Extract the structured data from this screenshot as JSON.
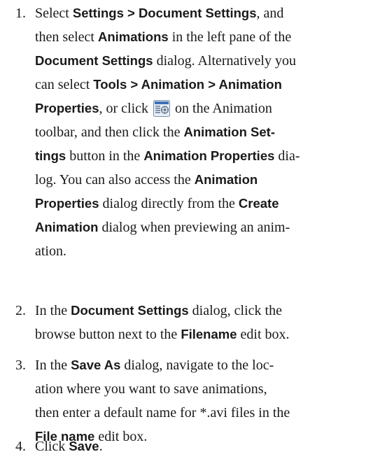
{
  "steps": [
    {
      "number": "1.",
      "lines": [
        [
          {
            "t": "Select "
          },
          {
            "b": "Settings > Document Settings"
          },
          {
            "t": ", and"
          }
        ],
        [
          {
            "t": "then select "
          },
          {
            "b": "Animations"
          },
          {
            "t": " in the left pane of the"
          }
        ],
        [
          {
            "b": "Document Settings"
          },
          {
            "t": " dialog. Alternatively you"
          }
        ],
        [
          {
            "t": "can select "
          },
          {
            "b": "Tools > Animation > Animation"
          }
        ],
        [
          {
            "b": "Properties"
          },
          {
            "t": ", or click "
          },
          {
            "icon": "animation-properties-icon"
          },
          {
            "t": " on the Animation"
          }
        ],
        [
          {
            "t": "toolbar, and then click the "
          },
          {
            "b": "Animation Set-"
          }
        ],
        [
          {
            "b": "tings"
          },
          {
            "t": " button in the "
          },
          {
            "b": "Animation Properties"
          },
          {
            "t": " dia-"
          }
        ],
        [
          {
            "t": "log. You can also access the "
          },
          {
            "b": "Animation"
          }
        ],
        [
          {
            "b": "Properties"
          },
          {
            "t": " dialog directly from the "
          },
          {
            "b": "Create"
          }
        ],
        [
          {
            "b": "Animation"
          },
          {
            "t": " dialog when previewing an anim-"
          }
        ],
        [
          {
            "t": "ation."
          }
        ]
      ]
    },
    {
      "number": "2.",
      "lines": [
        [
          {
            "t": "In the "
          },
          {
            "b": "Document Settings"
          },
          {
            "t": " dialog, click the"
          }
        ],
        [
          {
            "t": "browse button next to the "
          },
          {
            "b": "Filename"
          },
          {
            "t": " edit box."
          }
        ]
      ]
    },
    {
      "number": "3.",
      "lines": [
        [
          {
            "t": "In the "
          },
          {
            "b": "Save As"
          },
          {
            "t": " dialog, navigate to the loc-"
          }
        ],
        [
          {
            "t": "ation where you want to save animations,"
          }
        ],
        [
          {
            "t": "then enter a default name for *.avi files in the"
          }
        ],
        [
          {
            "b": "File name"
          },
          {
            "t": " edit box."
          }
        ]
      ]
    },
    {
      "number": "4.",
      "lines": [
        [
          {
            "t": "Click "
          },
          {
            "b": "Save"
          },
          {
            "t": "."
          }
        ]
      ]
    }
  ]
}
